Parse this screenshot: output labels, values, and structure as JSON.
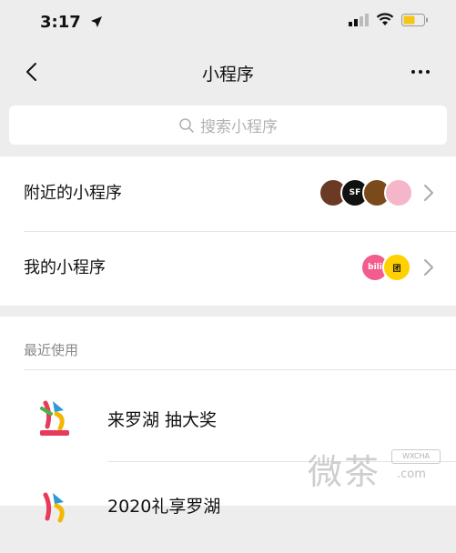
{
  "status_bar": {
    "time": "3:17"
  },
  "nav": {
    "title": "小程序"
  },
  "search": {
    "placeholder": "搜索小程序"
  },
  "rows": [
    {
      "label": "附近的小程序"
    },
    {
      "label": "我的小程序"
    }
  ],
  "my_app_avatars": [
    {
      "label": "bili",
      "color": "#f25d8e"
    },
    {
      "label": "团",
      "color": "#ffd100"
    }
  ],
  "nearby_avatars": [
    {
      "color": "#6b3a24"
    },
    {
      "label": "SF",
      "color": "#111111"
    },
    {
      "color": "#7a4a1a"
    },
    {
      "color": "#f4b6c8"
    }
  ],
  "recent": {
    "header": "最近使用",
    "items": [
      {
        "name": "来罗湖 抽大奖"
      },
      {
        "name": "2020礼享罗湖"
      }
    ]
  },
  "watermark": {
    "text": "微茶",
    "badge": "WXCHA",
    "domain": ".com"
  }
}
